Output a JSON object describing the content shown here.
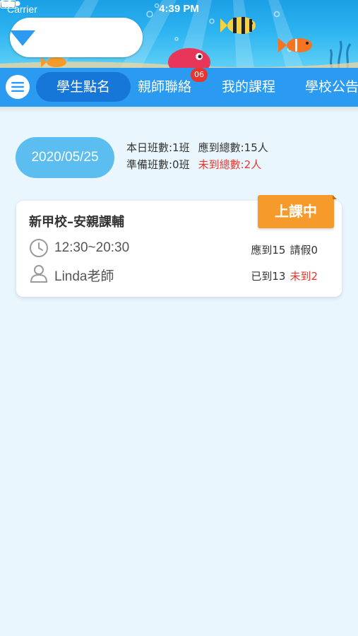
{
  "status_bar": {
    "carrier": "Carrier",
    "time": "4:39 PM"
  },
  "header": {
    "school_select_value": "",
    "icons": [
      "wifi-icon",
      "battery-icon",
      "chevron-down-icon",
      "more-icon",
      "menu-icon"
    ]
  },
  "tabs": [
    {
      "label": "學生點名",
      "active": true
    },
    {
      "label": "親師聯絡",
      "active": false,
      "badge": "06"
    },
    {
      "label": "我的課程",
      "active": false
    },
    {
      "label": "學校公告",
      "active": false
    }
  ],
  "summary": {
    "date": "2020/05/25",
    "classes_today": "本日班數:1班",
    "expected_total": "應到總數:15人",
    "preparing_classes": "準備班數:0班",
    "absent_total": "未到總數:2人"
  },
  "class_card": {
    "name": "新甲校–安親課輔",
    "status": "上課中",
    "time": "12:30~20:30",
    "teacher": "Linda老師",
    "expected": "應到15",
    "leave": "請假0",
    "arrived": "已到13",
    "absent": "未到2"
  },
  "colors": {
    "tabbar": "#2a9bf0",
    "active_tab": "#1677d8",
    "date_pill": "#5bbdf0",
    "status_badge": "#f59a2b",
    "alert_red": "#e8362e",
    "background": "#eaf6fd"
  }
}
